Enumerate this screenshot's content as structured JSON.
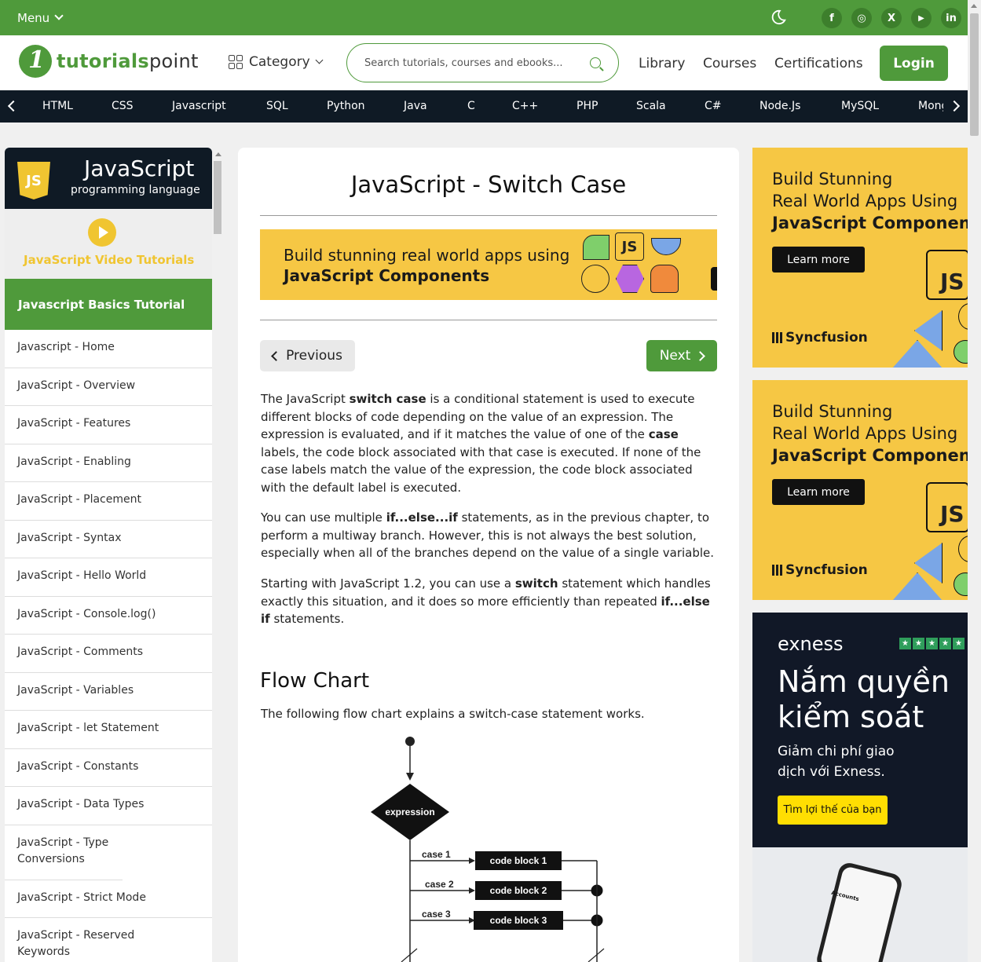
{
  "topbar": {
    "menu_label": "Menu",
    "icons": [
      "moon-icon",
      "facebook-icon",
      "instagram-icon",
      "x-icon",
      "youtube-icon",
      "linkedin-icon"
    ],
    "social_glyphs": [
      "f",
      "◎",
      "X",
      "▶",
      "in"
    ]
  },
  "header": {
    "logo_part1": "tutorials",
    "logo_part2": "point",
    "category_label": "Category",
    "search_placeholder": "Search tutorials, courses and ebooks...",
    "nav": [
      "Library",
      "Courses",
      "Certifications"
    ],
    "login_label": "Login"
  },
  "langbar": {
    "items": [
      "HTML",
      "CSS",
      "Javascript",
      "SQL",
      "Python",
      "Java",
      "C",
      "C++",
      "PHP",
      "Scala",
      "C#",
      "Node.Js",
      "MySQL",
      "Mong"
    ]
  },
  "sidebar": {
    "title": "JavaScript",
    "subtitle": "programming language",
    "badge_text": "JS",
    "video_label": "JavaScript Video Tutorials",
    "section_label": "Javascript Basics Tutorial",
    "items": [
      "Javascript - Home",
      "JavaScript - Overview",
      "JavaScript - Features",
      "JavaScript - Enabling",
      "JavaScript - Placement",
      "JavaScript - Syntax",
      "JavaScript - Hello World",
      "JavaScript - Console.log()",
      "JavaScript - Comments",
      "JavaScript - Variables",
      "JavaScript - let Statement",
      "JavaScript - Constants",
      "JavaScript - Data Types",
      "JavaScript - Type Conversions",
      "JavaScript - Strict Mode",
      "JavaScript - Reserved Keywords"
    ]
  },
  "main": {
    "title": "JavaScript - Switch Case",
    "banner_line1": "Build stunning real world apps using",
    "banner_line2": "JavaScript Components",
    "banner_js": "JS",
    "prev_label": "Previous",
    "next_label": "Next",
    "flow_heading": "Flow Chart",
    "flow_intro": "The following flow chart explains a switch-case statement works.",
    "flowchart": {
      "decision": "expression",
      "cases": [
        "case 1",
        "case 2",
        "case 3"
      ],
      "blocks": [
        "code block 1",
        "code block 2",
        "code block 3"
      ]
    }
  },
  "ads": {
    "line1": "Build Stunning",
    "line2": "Real World Apps Using",
    "line3": "JavaScript Components",
    "learn": "Learn more",
    "brand": "Syncfusion",
    "js": "JS"
  },
  "exness": {
    "logo": "exness",
    "headline1": "Nắm quyền",
    "headline2": "kiểm soát",
    "sub1": "Giảm chi phí giao",
    "sub2": "dịch với Exness.",
    "button": "Tìm lợi thế của bạn",
    "phone_title": "Accounts"
  },
  "colors": {
    "brand_green": "#4f9a3b",
    "dark_navy": "#0f1a25",
    "ad_yellow": "#f6c744"
  }
}
